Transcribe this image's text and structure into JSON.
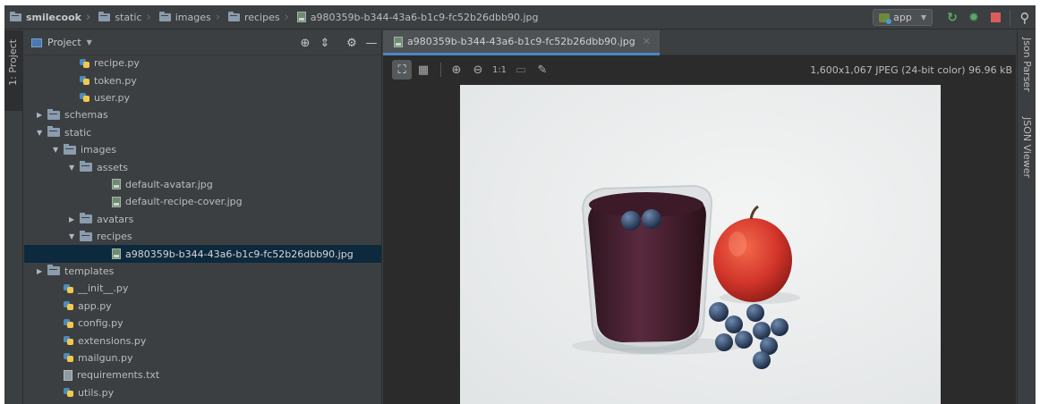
{
  "navbar": {
    "breadcrumbs": [
      {
        "label": "smilecook",
        "icon": "folder-icon"
      },
      {
        "label": "static",
        "icon": "folder-icon"
      },
      {
        "label": "images",
        "icon": "folder-icon"
      },
      {
        "label": "recipes",
        "icon": "folder-icon"
      },
      {
        "label": "a980359b-b344-43a6-b1c9-fc52b26dbb90.jpg",
        "icon": "image-file-icon"
      }
    ],
    "run_config": "app",
    "icons": [
      "rerun-icon",
      "debug-icon",
      "stop-icon",
      "search-icon"
    ]
  },
  "left_strip": {
    "project_tab": "1: Project"
  },
  "project_panel": {
    "title": "Project",
    "tree": [
      {
        "label": "recipe.py",
        "type": "py",
        "indent": 3
      },
      {
        "label": "token.py",
        "type": "py",
        "indent": 3
      },
      {
        "label": "user.py",
        "type": "py",
        "indent": 3
      },
      {
        "label": "schemas",
        "type": "folder",
        "indent": 1,
        "state": "collapsed"
      },
      {
        "label": "static",
        "type": "folder",
        "indent": 1,
        "state": "expanded"
      },
      {
        "label": "images",
        "type": "folder",
        "indent": 2,
        "state": "expanded"
      },
      {
        "label": "assets",
        "type": "folder",
        "indent": 3,
        "state": "expanded"
      },
      {
        "label": "default-avatar.jpg",
        "type": "image",
        "indent": 5
      },
      {
        "label": "default-recipe-cover.jpg",
        "type": "image",
        "indent": 5
      },
      {
        "label": "avatars",
        "type": "folder",
        "indent": 3,
        "state": "collapsed"
      },
      {
        "label": "recipes",
        "type": "folder",
        "indent": 3,
        "state": "expanded"
      },
      {
        "label": "a980359b-b344-43a6-b1c9-fc52b26dbb90.jpg",
        "type": "image",
        "indent": 5,
        "selected": true
      },
      {
        "label": "templates",
        "type": "folder",
        "indent": 1,
        "state": "collapsed"
      },
      {
        "label": "__init__.py",
        "type": "py",
        "indent": 2
      },
      {
        "label": "app.py",
        "type": "py",
        "indent": 2
      },
      {
        "label": "config.py",
        "type": "py",
        "indent": 2
      },
      {
        "label": "extensions.py",
        "type": "py",
        "indent": 2
      },
      {
        "label": "mailgun.py",
        "type": "py",
        "indent": 2
      },
      {
        "label": "requirements.txt",
        "type": "txt",
        "indent": 2
      },
      {
        "label": "utils.py",
        "type": "py",
        "indent": 2
      }
    ]
  },
  "editor": {
    "tab_label": "a980359b-b344-43a6-b1c9-fc52b26dbb90.jpg",
    "image_info": "1,600x1,067 JPEG (24-bit color) 96.96 kB",
    "toolbar": {
      "actual_size_label": "1:1"
    }
  },
  "right_strip": {
    "tabs": [
      "Json Parser",
      "JSON Viewer"
    ]
  }
}
